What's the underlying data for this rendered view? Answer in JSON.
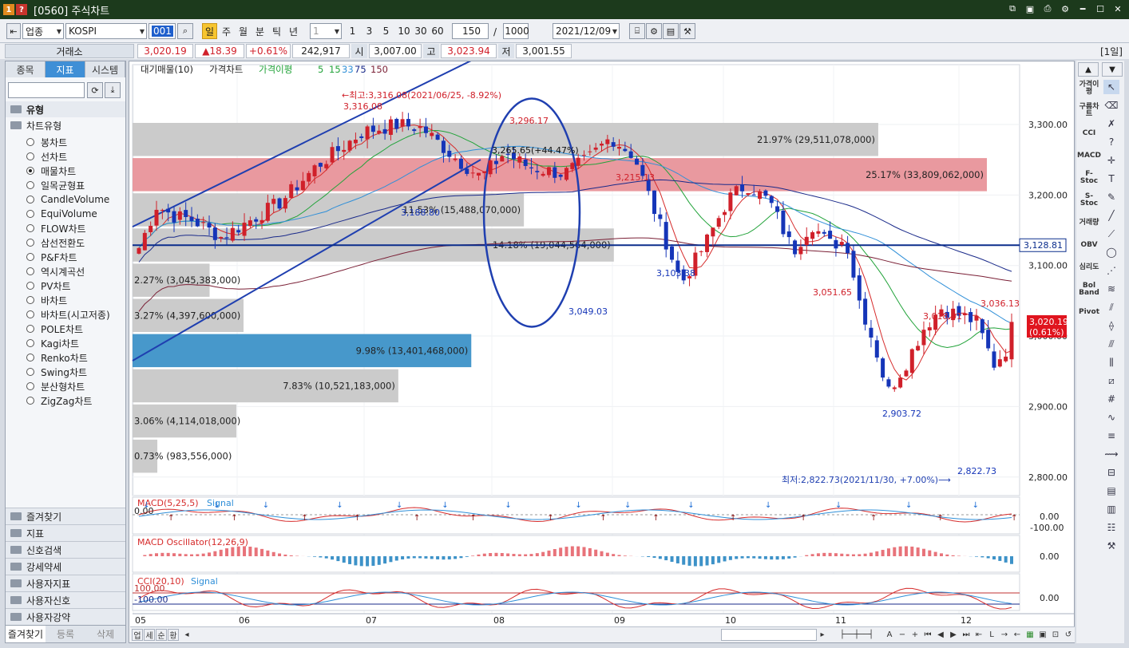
{
  "window": {
    "badge1": "1",
    "badge2": "?",
    "title": "[0560] 주식차트"
  },
  "toolbar": {
    "market": "업종",
    "index": "KOSPI",
    "code": "001",
    "periods": [
      "일",
      "주",
      "월",
      "분",
      "틱",
      "년"
    ],
    "active_period": "일",
    "interval": "1",
    "quick": [
      "1",
      "3",
      "5",
      "10",
      "30",
      "60"
    ],
    "count": "150",
    "slash": "/",
    "max": "1000",
    "date": "2021/12/09"
  },
  "quote": {
    "exchange": "거래소",
    "price": "3,020.19",
    "change": "▲18.39",
    "pct": "+0.61%",
    "volume": "242,917",
    "open_label": "시",
    "open": "3,007.00",
    "high_label": "고",
    "high": "3,023.94",
    "low_label": "저",
    "low": "3,001.55",
    "period": "[1일]"
  },
  "left": {
    "tabs": [
      "종목",
      "지표",
      "시스템"
    ],
    "active_tab": "지표",
    "section": "유형",
    "tree_label": "차트유형",
    "types": [
      "봉차트",
      "선차트",
      "매물차트",
      "일목균형표",
      "CandleVolume",
      "EquiVolume",
      "FLOW차트",
      "삼선전환도",
      "P&F차트",
      "역시계곡선",
      "PV차트",
      "바차트",
      "바차트(시고저종)",
      "POLE차트",
      "Kagi차트",
      "Renko차트",
      "Swing차트",
      "분산형차트",
      "ZigZag차트"
    ],
    "selected": 2,
    "bottom_sections": [
      "즐겨찾기",
      "지표",
      "신호검색",
      "강세약세",
      "사용자지표",
      "사용자신호",
      "사용자강약"
    ],
    "bottom_tabs": [
      "즐겨찾기",
      "등록",
      "삭제"
    ]
  },
  "chart": {
    "legend": [
      "대기매물(10)",
      "가격차트",
      "가격이평",
      "5",
      "15",
      "33",
      "75",
      "150"
    ],
    "annotations": {
      "high": "←최고:3,316.08(2021/06/25, -8.92%)",
      "high_price": "3,316.08",
      "p3296": "3,296.17",
      "p3265": "3,265.65(+44.47%)",
      "p3215": "3,215.13",
      "p3188": "3,188.80",
      "p3103": "3,103.38",
      "p3049": "3,049.03",
      "p3051": "3,051.65",
      "p3018": "3,018.01",
      "p3036": "3,036.13",
      "p2903": "2,903.72",
      "p2822": "2,822.73",
      "low": "최저:2,822.73(2021/11/30, +7.00%)⟶",
      "hline": "3,128.81",
      "last": "3,020.19",
      "last_pct": "(0.61%)"
    },
    "y_ticks": [
      "3,300.00",
      "3,200.00",
      "3,100.00",
      "3,000.00",
      "2,900.00",
      "2,800.00"
    ],
    "x_ticks": [
      "05",
      "06",
      "07",
      "08",
      "09",
      "10",
      "11",
      "12"
    ],
    "volume_profile": [
      {
        "label": "21.97% (29,511,078,000)",
        "pct": 21.97,
        "color": "#c8c8c8"
      },
      {
        "label": "25.17% (33,809,062,000)",
        "pct": 25.17,
        "color": "#e8939a"
      },
      {
        "label": "11.53% (15,488,070,000)",
        "pct": 11.53,
        "color": "#c8c8c8"
      },
      {
        "label": "14.18% (19,044,564,000)",
        "pct": 14.18,
        "color": "#c8c8c8"
      },
      {
        "label": "2.27% (3,045,383,000)",
        "pct": 2.27,
        "color": "#c8c8c8"
      },
      {
        "label": "3.27% (4,397,600,000)",
        "pct": 3.27,
        "color": "#c8c8c8"
      },
      {
        "label": "9.98% (13,401,468,000)",
        "pct": 9.98,
        "color": "#3d92c8"
      },
      {
        "label": "7.83% (10,521,183,000)",
        "pct": 7.83,
        "color": "#c8c8c8"
      },
      {
        "label": "3.06% (4,114,018,000)",
        "pct": 3.06,
        "color": "#c8c8c8"
      },
      {
        "label": "0.73% (983,556,000)",
        "pct": 0.73,
        "color": "#c8c8c8"
      }
    ],
    "macd": {
      "title": "MACD(5,25,5)",
      "signal": "Signal",
      "zero": "0.00",
      "axis": [
        "0.00",
        "-100.00"
      ]
    },
    "osc": {
      "title": "MACD Oscillator(12,26,9)",
      "axis": "0.00"
    },
    "cci": {
      "title": "CCI(20,10)",
      "signal": "Signal",
      "lines": [
        "100.00",
        "-100.00"
      ],
      "axis": "0.00"
    },
    "scroll_tabs": [
      "업",
      "세",
      "순",
      "황"
    ]
  },
  "right": {
    "indicators": [
      "가격이평",
      "구름차트",
      "CCI",
      "MACD",
      "F-Stoc",
      "S-Stoc",
      "거래량",
      "OBV",
      "심리도",
      "Bol Band",
      "Pivot"
    ]
  },
  "colors": {
    "up": "#d0202a",
    "down": "#1535b8",
    "accent": "#3f8fd6",
    "hline": "#0b2d8c"
  }
}
